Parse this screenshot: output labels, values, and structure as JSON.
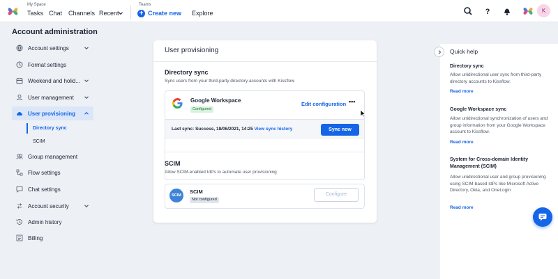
{
  "topbar": {
    "my_space_caption": "My Space",
    "teams_caption": "Teams",
    "nav": {
      "tasks": "Tasks",
      "chat": "Chat",
      "channels": "Channels",
      "recent": "Recent",
      "create_new": "Create new",
      "explore": "Explore"
    },
    "avatar_initial": "K"
  },
  "sidebar": {
    "title": "Account administration",
    "items": [
      {
        "label": "Account settings"
      },
      {
        "label": "Format settings"
      },
      {
        "label": "Weekend and holid..."
      },
      {
        "label": "User management"
      },
      {
        "label": "User provisioning"
      },
      {
        "label": "Group management"
      },
      {
        "label": "Flow settings"
      },
      {
        "label": "Chat settings"
      },
      {
        "label": "Account security"
      },
      {
        "label": "Admin history"
      },
      {
        "label": "Billing"
      }
    ],
    "sub_items": [
      {
        "label": "Directory sync"
      },
      {
        "label": "SCIM"
      }
    ]
  },
  "main": {
    "title": "User provisioning",
    "directory_sync": {
      "title": "Directory sync",
      "description": "Sync users from your third-party directory accounts with Kissflow",
      "provider_name": "Google Workspace",
      "status_badge": "Configured",
      "edit_label": "Edit configuration",
      "more_label": "•••",
      "last_sync_text": "Last sync: Success, 18/06/2021, 14:25",
      "view_history_label": "View sync history",
      "sync_now_label": "Sync now"
    },
    "scim": {
      "title": "SCIM",
      "description": "Allow SCIM-enabled IdPs to automate user provisioning",
      "logo_text": "SCIM",
      "name": "SCIM",
      "status_badge": "Not configured",
      "configure_label": "Configure"
    }
  },
  "help": {
    "title": "Quick help",
    "sections": [
      {
        "heading": "Directory sync",
        "text": "Allow unidirectional user sync from third-party directory accounts to Kissflow.",
        "link": "Read more"
      },
      {
        "heading": "Google Workspace sync",
        "text": "Allow unidirectional synchronization of users and group information from your Google Workspace account to Kissflow.",
        "link": "Read more"
      },
      {
        "heading": "System for Cross-domain Identity Management (SCIM)",
        "text": "Allow unidirectional user and group provisioning using SCIM-based IdPs like Microsoft Active Directory, Okta, and OneLogin",
        "link": "Read more"
      }
    ]
  },
  "colors": {
    "accent": "#1565e6",
    "background": "#edf1f6",
    "success_badge": "#d9f1df"
  },
  "icons": [
    "kissflow-logo",
    "search-icon",
    "help-icon",
    "bell-icon",
    "chevron-down-icon",
    "chevron-right-icon",
    "chat-icon"
  ]
}
